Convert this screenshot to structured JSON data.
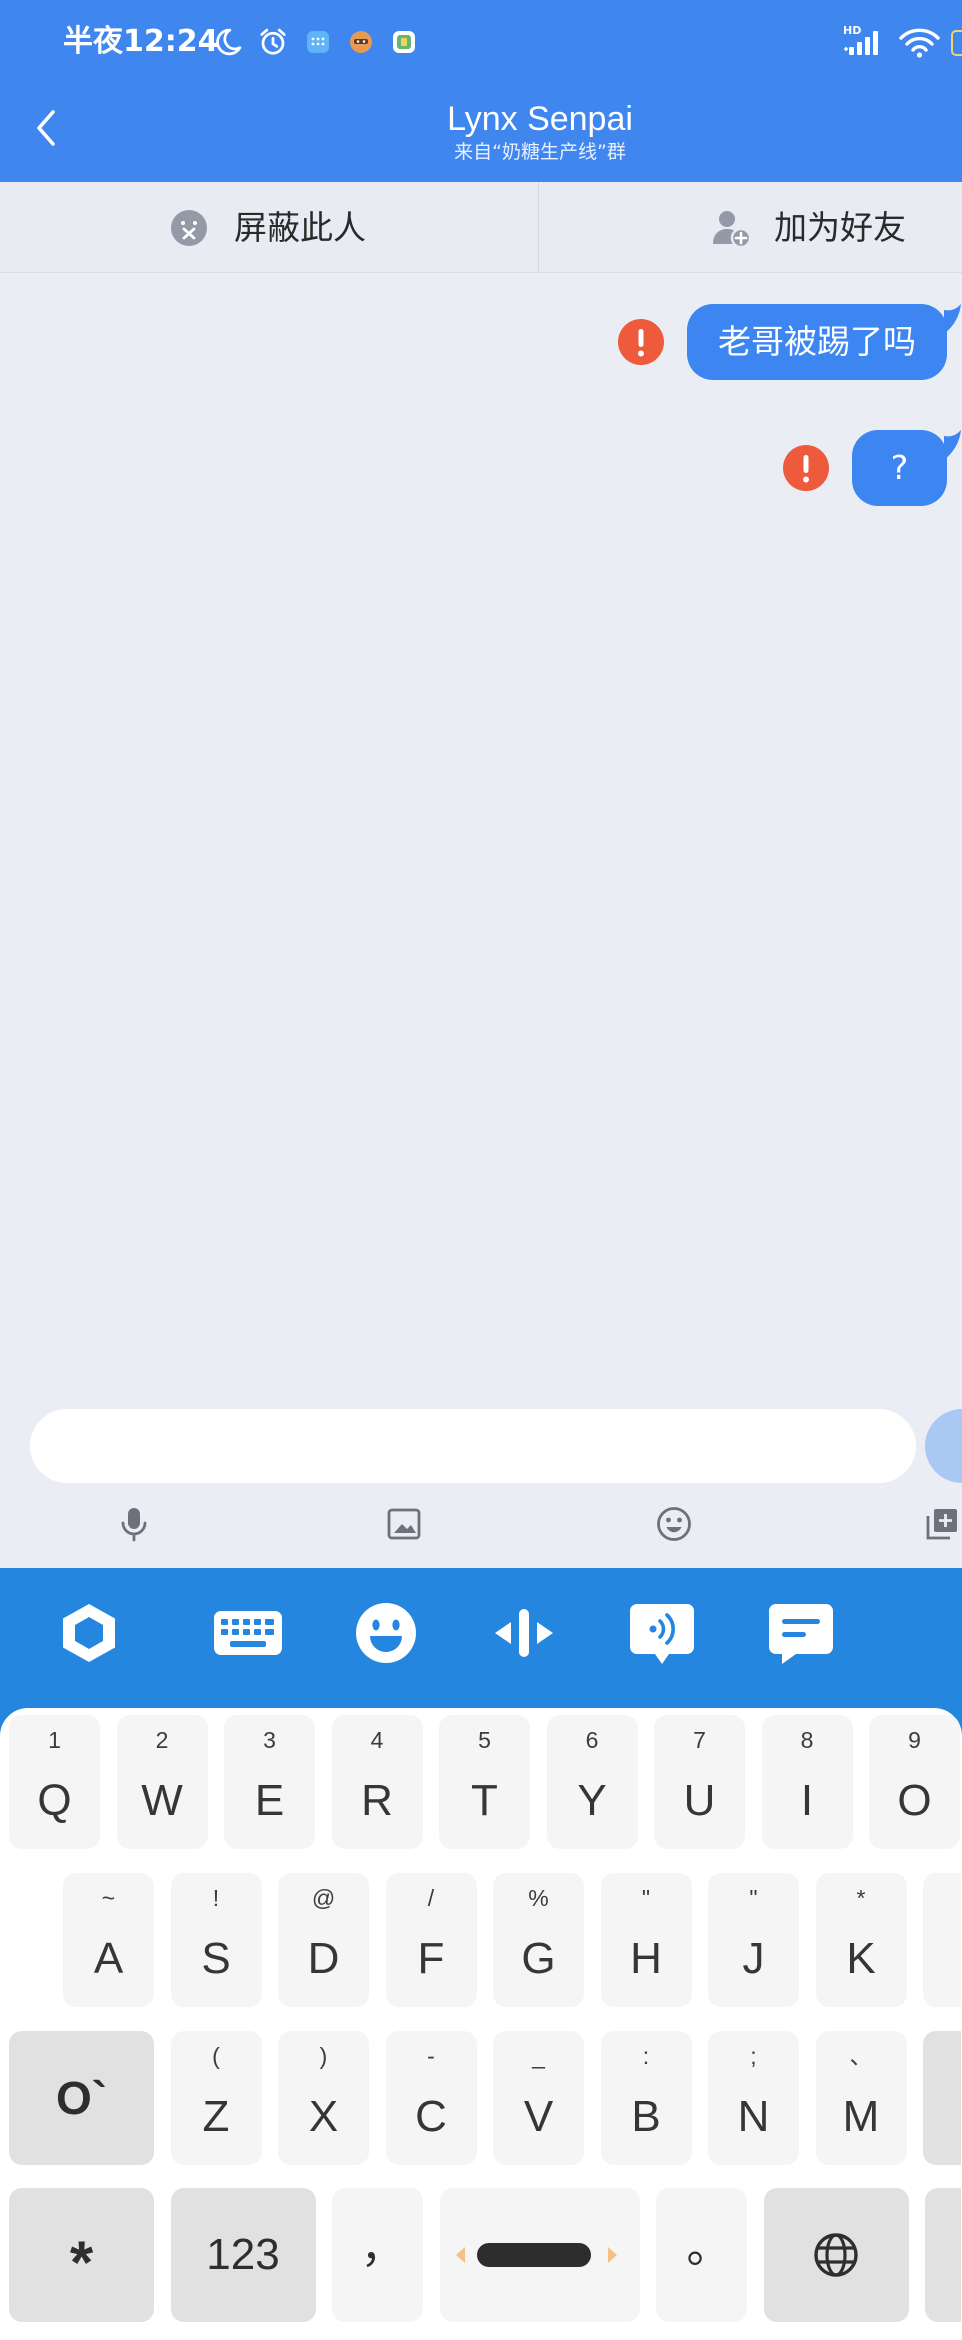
{
  "status_bar": {
    "time": "半夜12:24",
    "network_label": "HD",
    "icons": [
      "moon-icon",
      "alarm-icon",
      "app-grid-icon",
      "app-face-icon",
      "app-note-icon",
      "signal-icon",
      "wifi-icon",
      "battery-icon"
    ]
  },
  "header": {
    "title": "Lynx Senpai",
    "subtitle": "来自“奶糖生产线”群",
    "back_icon": "chevron-left-icon"
  },
  "action_bar": {
    "block": {
      "label": "屏蔽此人",
      "icon": "block-user-icon"
    },
    "add_friend": {
      "label": "加为好友",
      "icon": "add-user-icon"
    }
  },
  "messages": [
    {
      "text": "老哥被踢了吗",
      "sender": "self",
      "status": "failed",
      "status_icon": "error-icon"
    },
    {
      "text": "?",
      "sender": "self",
      "status": "failed",
      "status_icon": "error-icon"
    }
  ],
  "composer": {
    "input_value": "",
    "input_placeholder": "",
    "send_icon": "send-icon",
    "tools": [
      "mic-icon",
      "image-icon",
      "emoji-icon",
      "more-icon"
    ]
  },
  "keyboard_toolbar": {
    "icons": [
      "keyboard-logo-icon",
      "keyboard-layout-icon",
      "emoji-icon",
      "cursor-move-icon",
      "voice-input-icon",
      "quick-phrase-icon"
    ]
  },
  "keyboard": {
    "rows": [
      {
        "keys": [
          {
            "label": "Q",
            "hint": "1"
          },
          {
            "label": "W",
            "hint": "2"
          },
          {
            "label": "E",
            "hint": "3"
          },
          {
            "label": "R",
            "hint": "4"
          },
          {
            "label": "T",
            "hint": "5"
          },
          {
            "label": "Y",
            "hint": "6"
          },
          {
            "label": "U",
            "hint": "7"
          },
          {
            "label": "I",
            "hint": "8"
          },
          {
            "label": "O",
            "hint": "9"
          }
        ]
      },
      {
        "keys": [
          {
            "label": "A",
            "hint": "~"
          },
          {
            "label": "S",
            "hint": "!"
          },
          {
            "label": "D",
            "hint": "@"
          },
          {
            "label": "F",
            "hint": "/"
          },
          {
            "label": "G",
            "hint": "%"
          },
          {
            "label": "H",
            "hint": "\""
          },
          {
            "label": "J",
            "hint": "\""
          },
          {
            "label": "K",
            "hint": "*"
          }
        ]
      },
      {
        "keys": [
          {
            "label": "Z",
            "hint": "("
          },
          {
            "label": "X",
            "hint": ")"
          },
          {
            "label": "C",
            "hint": "-"
          },
          {
            "label": "V",
            "hint": "_"
          },
          {
            "label": "B",
            "hint": ":"
          },
          {
            "label": "N",
            "hint": ";"
          },
          {
            "label": "M",
            "hint": "、"
          }
        ]
      }
    ],
    "separator_key": "O`",
    "symbol_key": "*",
    "numeric_key": "123",
    "comma_key": "，",
    "period_key": "。",
    "space_key_icon": "cursor-handle-icon",
    "language_key_icon": "globe-icon"
  },
  "colors": {
    "header_bg": "#3f86ef",
    "bubble_bg": "#3d86f2",
    "error_red": "#ee5a3c",
    "keyboard_toolbar_bg": "#2586df",
    "chat_bg": "#eaedf4",
    "action_bar_bg": "#e8ebf2",
    "key_bg": "#f5f5f5",
    "function_key_bg": "#e1e1e1",
    "send_button_bg": "#a9c8f4"
  }
}
